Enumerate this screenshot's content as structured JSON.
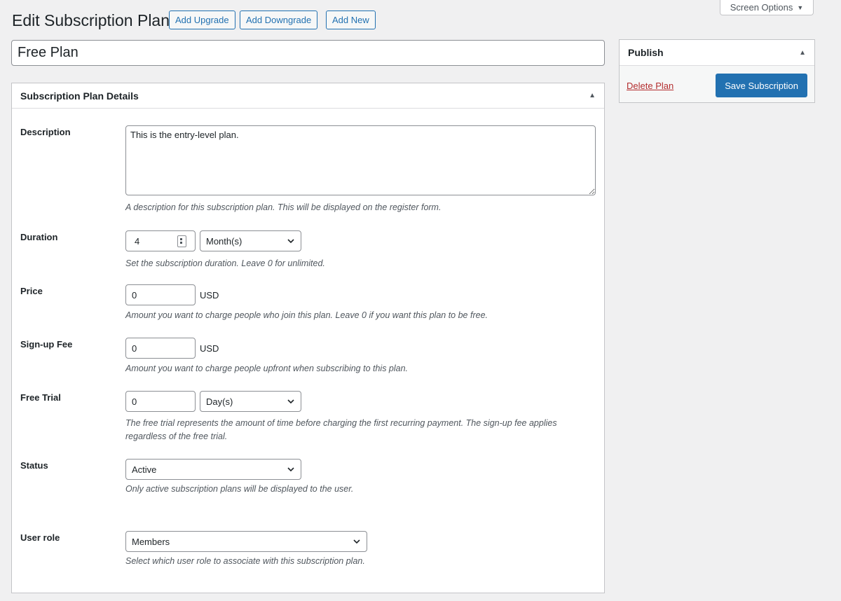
{
  "screen_options": {
    "label": "Screen Options"
  },
  "page": {
    "title": "Edit Subscription Plan",
    "buttons": {
      "add_upgrade": "Add Upgrade",
      "add_downgrade": "Add Downgrade",
      "add_new": "Add New"
    },
    "plan_name": "Free Plan"
  },
  "publish": {
    "title": "Publish",
    "delete_label": "Delete Plan",
    "save_label": "Save Subscription"
  },
  "details": {
    "title": "Subscription Plan Details",
    "description": {
      "label": "Description",
      "value": "This is the entry-level plan.",
      "hint": "A description for this subscription plan. This will be displayed on the register form."
    },
    "duration": {
      "label": "Duration",
      "value": "4",
      "unit": "Month(s)",
      "hint": "Set the subscription duration. Leave 0 for unlimited."
    },
    "price": {
      "label": "Price",
      "value": "0",
      "currency": "USD",
      "hint": "Amount you want to charge people who join this plan. Leave 0 if you want this plan to be free."
    },
    "signup_fee": {
      "label": "Sign-up Fee",
      "value": "0",
      "currency": "USD",
      "hint": "Amount you want to charge people upfront when subscribing to this plan."
    },
    "free_trial": {
      "label": "Free Trial",
      "value": "0",
      "unit": "Day(s)",
      "hint": "The free trial represents the amount of time before charging the first recurring payment. The sign-up fee applies regardless of the free trial."
    },
    "status": {
      "label": "Status",
      "value": "Active",
      "hint": "Only active subscription plans will be displayed to the user."
    },
    "user_role": {
      "label": "User role",
      "value": "Members",
      "hint": "Select which user role to associate with this subscription plan."
    }
  },
  "colors": {
    "primary": "#2271b1",
    "danger": "#b32d2e",
    "background": "#f0f0f1"
  }
}
